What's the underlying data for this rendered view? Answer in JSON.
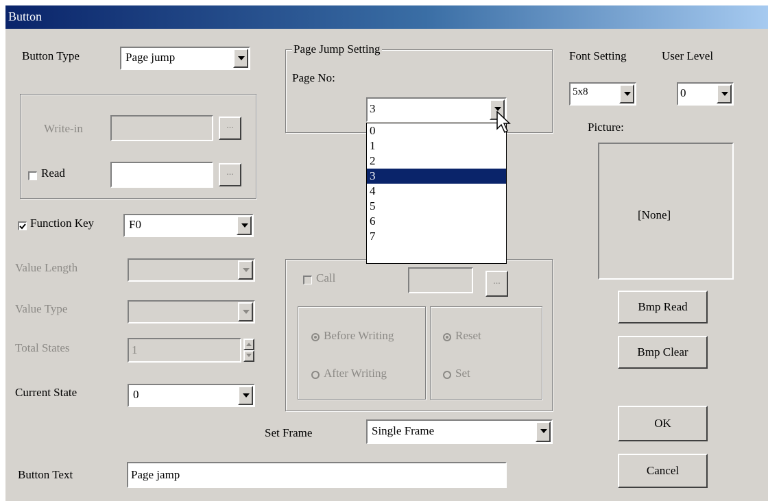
{
  "window": {
    "title": "Button"
  },
  "button_type": {
    "label": "Button Type",
    "value": "Page jump"
  },
  "write_in": {
    "label": "Write-in",
    "browse": "..."
  },
  "read": {
    "label": "Read",
    "browse": "..."
  },
  "function_key": {
    "label": "Function Key",
    "value": "F0"
  },
  "value_length": {
    "label": "Value Length"
  },
  "value_type": {
    "label": "Value Type"
  },
  "total_states": {
    "label": "Total States",
    "value": "1"
  },
  "current_state": {
    "label": "Current State",
    "value": "0"
  },
  "page_jump": {
    "legend": "Page Jump Setting",
    "page_no_label": "Page No:",
    "value": "3",
    "options": [
      "0",
      "1",
      "2",
      "3",
      "4",
      "5",
      "6",
      "7"
    ],
    "selected_index": 3
  },
  "call": {
    "label": "Call",
    "browse": "...",
    "before_writing": "Before Writing",
    "after_writing": "After Writing",
    "reset": "Reset",
    "set": "Set"
  },
  "set_frame": {
    "label": "Set Frame",
    "value": "Single Frame"
  },
  "button_text": {
    "label": "Button Text",
    "value": "Page jamp"
  },
  "font_setting": {
    "label": "Font Setting",
    "value": "5x8"
  },
  "user_level": {
    "label": "User Level",
    "value": "0"
  },
  "picture": {
    "label": "Picture:",
    "placeholder": "[None]"
  },
  "buttons": {
    "bmp_read": "Bmp Read",
    "bmp_clear": "Bmp Clear",
    "ok": "OK",
    "cancel": "Cancel"
  }
}
